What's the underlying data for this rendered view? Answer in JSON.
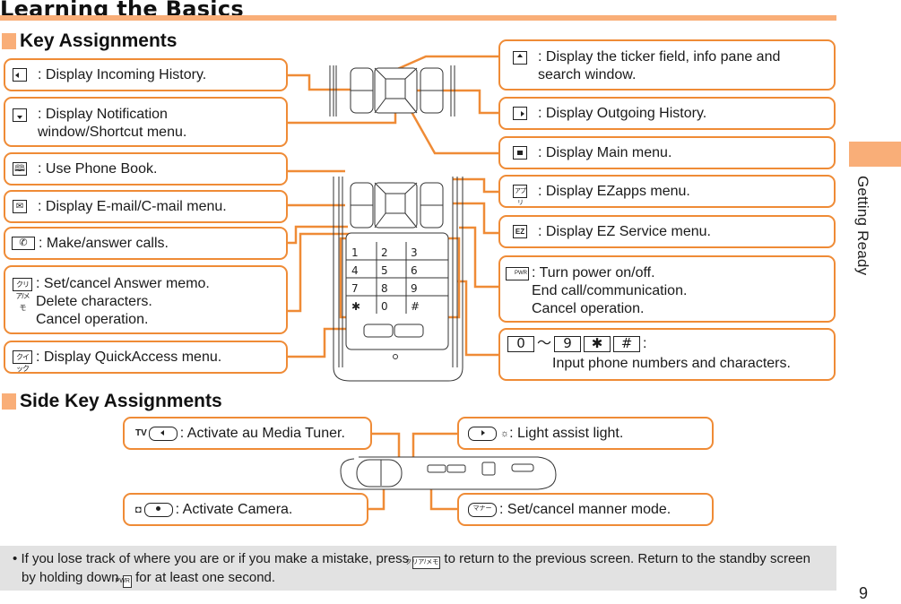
{
  "header": {
    "title": "Learning the Basics"
  },
  "side_tab": {
    "label": "Getting Ready"
  },
  "page_number": "9",
  "key_assignments": {
    "heading": "Key Assignments",
    "left": [
      {
        "key": "left-key",
        "text": ": Display Incoming History."
      },
      {
        "key": "down-key",
        "text": ": Display Notification\nwindow/Shortcut menu."
      },
      {
        "key": "phonebook-key",
        "text": ": Use Phone Book."
      },
      {
        "key": "mail-key",
        "text": ": Display E-mail/C-mail menu."
      },
      {
        "key": "call-key",
        "text": ": Make/answer calls."
      },
      {
        "key": "clear-memo-key",
        "key_label": "クリア/メモ",
        "text": ": Set/cancel Answer memo.\nDelete characters.\nCancel operation."
      },
      {
        "key": "quick-key",
        "key_label": "クイック",
        "text": ": Display QuickAccess menu."
      }
    ],
    "right": [
      {
        "key": "up-key",
        "text": ": Display the ticker field, info pane and\nsearch window."
      },
      {
        "key": "right-key",
        "text": ": Display Outgoing History."
      },
      {
        "key": "center-key",
        "text": ": Display Main menu."
      },
      {
        "key": "apps-key",
        "key_label": "アプリ",
        "text": ": Display EZapps menu."
      },
      {
        "key": "ez-key",
        "key_label": "EZ",
        "text": ": Display EZ Service menu."
      },
      {
        "key": "power-key",
        "key_label": "PWR",
        "text": ": Turn power on/off.\nEnd call/communication.\nCancel operation."
      },
      {
        "key": "number-keys",
        "keys": [
          "0",
          "9",
          "✱",
          "#"
        ],
        "tilde": "～",
        "colon": ":",
        "text": "Input phone numbers and characters."
      }
    ]
  },
  "side_key_assignments": {
    "heading": "Side Key Assignments",
    "items": [
      {
        "key": "tv-key",
        "prefix": "TV",
        "text": ":  Activate au Media Tuner."
      },
      {
        "key": "camera-key",
        "text": ":  Activate Camera."
      },
      {
        "key": "light-key",
        "text": ": Light assist light."
      },
      {
        "key": "manner-key",
        "key_label": "マナー",
        "text": ": Set/cancel manner mode."
      }
    ]
  },
  "note": {
    "part1": "If you lose track of where you are or if you make a mistake, press",
    "key1": "クリア/メモ",
    "part2": "to return to the previous screen. Return to the",
    "part3": "standby screen by holding down",
    "key2": "PWR",
    "part4": "for at least one second."
  },
  "colors": {
    "accent": "#f9ae78",
    "box_border": "#ef8b36",
    "note_bg": "#e2e2e2"
  }
}
